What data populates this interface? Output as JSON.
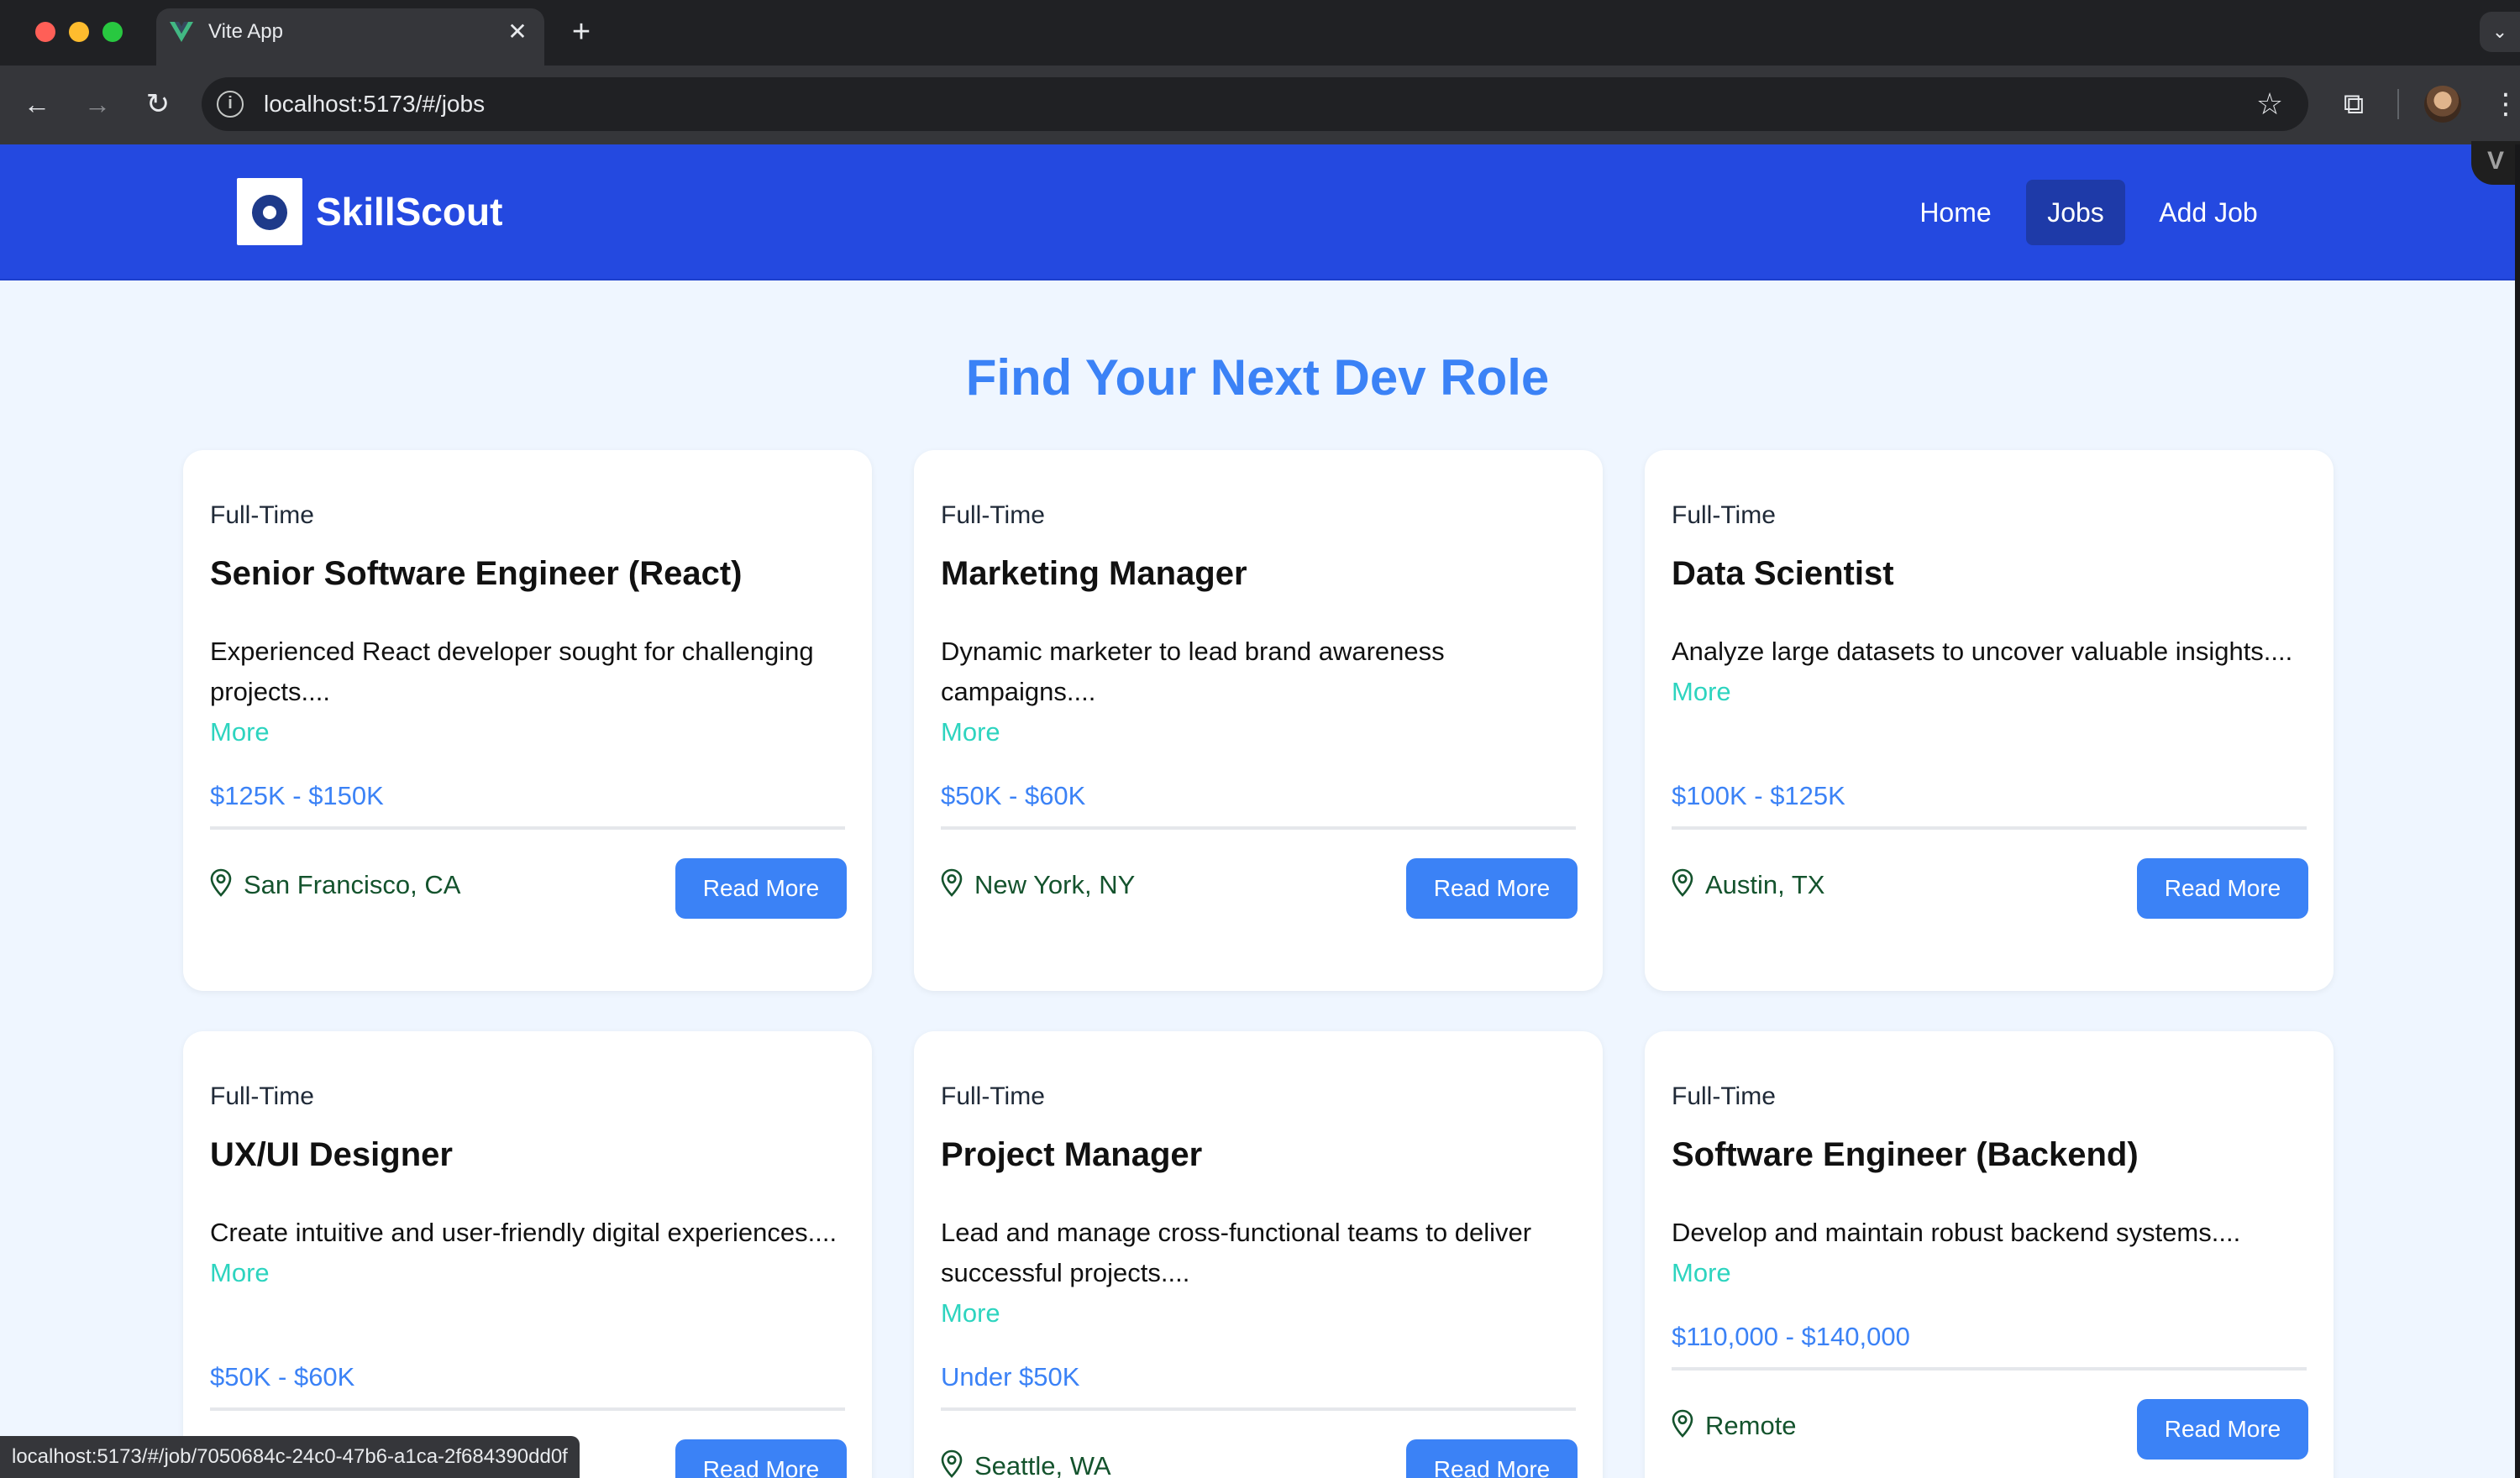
{
  "browser": {
    "tab_title": "Vite App",
    "tab_close": "✕",
    "new_tab": "+",
    "url": "localhost:5173/#/jobs",
    "status_url": "localhost:5173/#/job/7050684c-24c0-47b6-a1ca-2f684390dd0f",
    "icons": {
      "back": "←",
      "forward": "→",
      "reload": "↻",
      "info": "i",
      "star": "☆",
      "extension": "⧉",
      "menu": "⋮",
      "tab_search": "⌄",
      "devtools": "V"
    }
  },
  "header": {
    "brand": "SkillScout",
    "nav": [
      {
        "label": "Home",
        "active": false
      },
      {
        "label": "Jobs",
        "active": true
      },
      {
        "label": "Add Job",
        "active": false
      }
    ],
    "colors": {
      "nav_bg": "#2449e0",
      "active_bg": "#1e3aa8"
    }
  },
  "page": {
    "title": "Find Your Next Dev Role",
    "more_label": "More",
    "read_more_label": "Read More"
  },
  "jobs": [
    {
      "type": "Full-Time",
      "title": "Senior Software Engineer (React)",
      "description": "Experienced React developer sought for challenging projects....",
      "salary": "$125K - $150K",
      "location": "San Francisco, CA"
    },
    {
      "type": "Full-Time",
      "title": "Marketing Manager",
      "description": "Dynamic marketer to lead brand awareness campaigns....",
      "salary": "$50K - $60K",
      "location": "New York, NY"
    },
    {
      "type": "Full-Time",
      "title": "Data Scientist",
      "description": "Analyze large datasets to uncover valuable insights....",
      "salary": "$100K - $125K",
      "location": "Austin, TX"
    },
    {
      "type": "Full-Time",
      "title": "UX/UI Designer",
      "description": "Create intuitive and user-friendly digital experiences....",
      "salary": "$50K - $60K",
      "location": ""
    },
    {
      "type": "Full-Time",
      "title": "Project Manager",
      "description": "Lead and manage cross-functional teams to deliver successful projects....",
      "salary": "Under $50K",
      "location": "Seattle, WA"
    },
    {
      "type": "Full-Time",
      "title": "Software Engineer (Backend)",
      "description": "Develop and maintain robust backend systems....",
      "salary": "$110,000 - $140,000",
      "location": "Remote"
    }
  ]
}
